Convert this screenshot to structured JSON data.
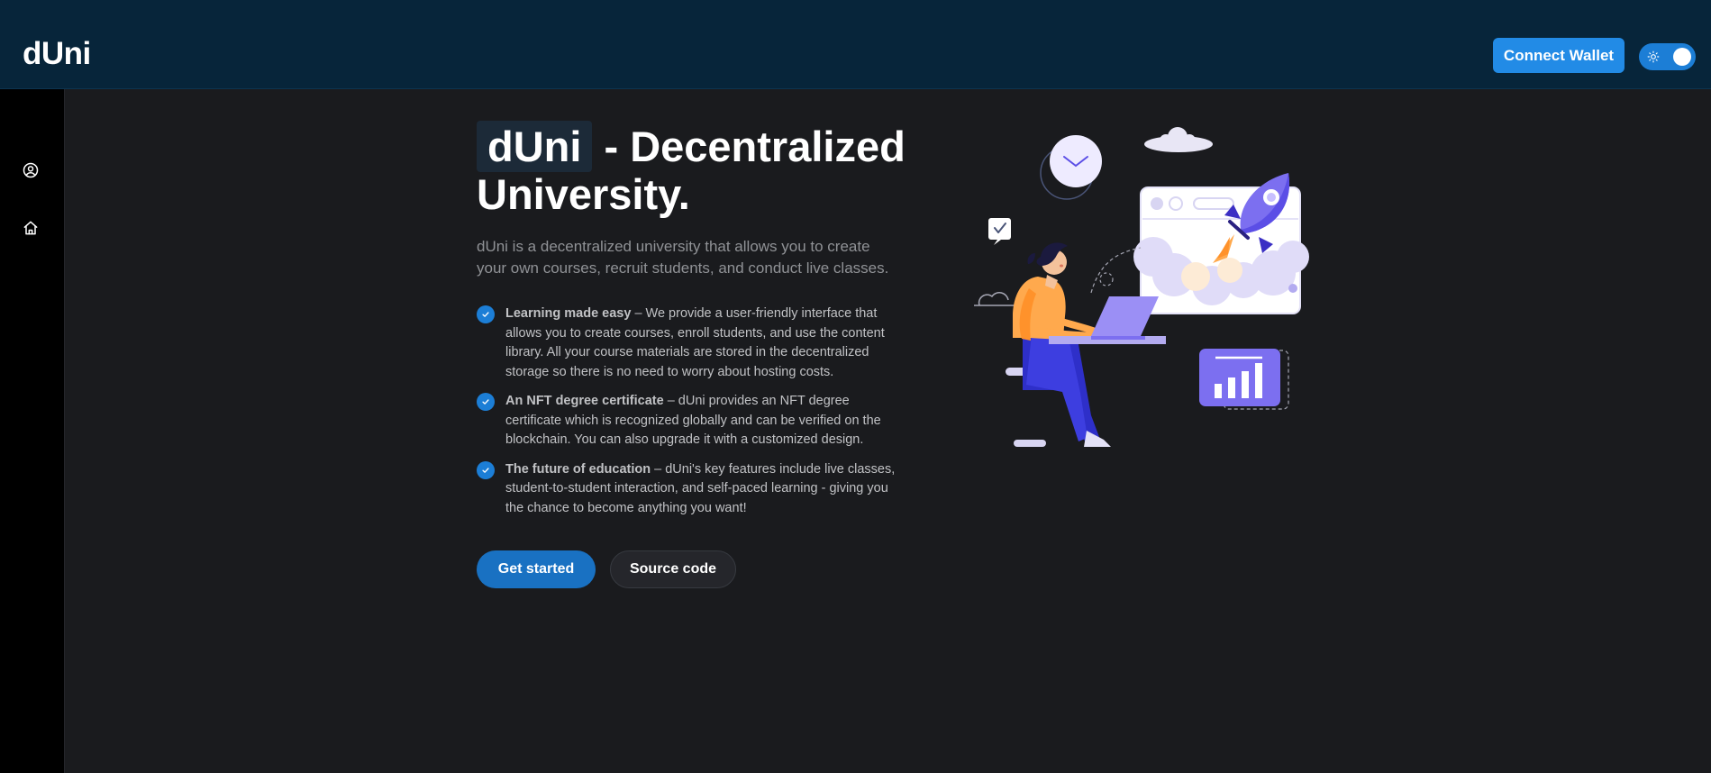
{
  "header": {
    "logo": "dUni",
    "connect_wallet": "Connect Wallet",
    "theme_toggle_icon": "sun-icon"
  },
  "sidebar": {
    "items": [
      {
        "icon": "user-circle-icon"
      },
      {
        "icon": "home-icon"
      }
    ]
  },
  "hero": {
    "title_highlight": "dUni",
    "title_rest": " - Decentralized University.",
    "description": "dUni is a decentralized university that allows you to create your own courses, recruit students, and conduct live classes.",
    "features": [
      {
        "title": "Learning made easy",
        "text": " – We provide a user-friendly interface that allows you to create courses, enroll students, and use the content library. All your course materials are stored in the decentralized storage so there is no need to worry about hosting costs."
      },
      {
        "title": "An NFT degree certificate",
        "text": " – dUni provides an NFT degree certificate which is recognized globally and can be verified on the blockchain. You can also upgrade it with a customized design."
      },
      {
        "title": "The future of education",
        "text": " – dUni's key features include live classes, student-to-student interaction, and self-paced learning - giving you the chance to become anything you want!"
      }
    ],
    "primary_button": "Get started",
    "secondary_button": "Source code"
  },
  "colors": {
    "header_bg": "#07253a",
    "page_bg": "#1a1b1e",
    "accent": "#228be6",
    "illustration_purple": "#7c6ff0"
  }
}
